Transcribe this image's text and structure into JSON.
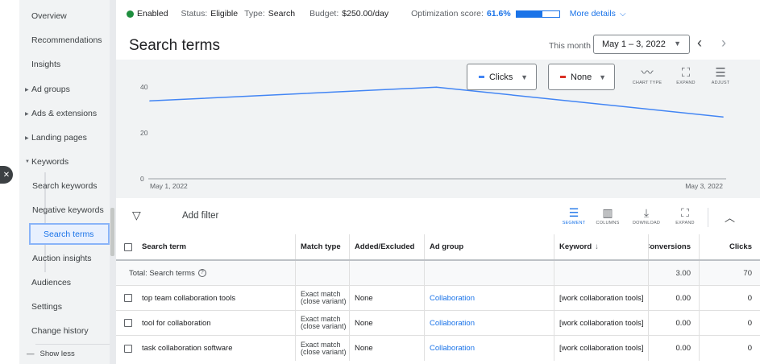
{
  "sidebar": {
    "items": [
      {
        "label": "Overview"
      },
      {
        "label": "Recommendations"
      },
      {
        "label": "Insights"
      },
      {
        "label": "Ad groups"
      },
      {
        "label": "Ads & extensions"
      },
      {
        "label": "Landing pages"
      },
      {
        "label": "Keywords"
      },
      {
        "label": "Search keywords"
      },
      {
        "label": "Negative keywords"
      },
      {
        "label": "Search terms"
      },
      {
        "label": "Auction insights"
      },
      {
        "label": "Audiences"
      },
      {
        "label": "Settings"
      },
      {
        "label": "Change history"
      }
    ],
    "show_less": "Show less"
  },
  "status": {
    "enabled": "Enabled",
    "status_label": "Status:",
    "status_value": "Eligible",
    "type_label": "Type:",
    "type_value": "Search",
    "budget_label": "Budget:",
    "budget_value": "$250.00/day",
    "opt_label": "Optimization score:",
    "opt_value": "61.6%",
    "opt_fraction": 0.616,
    "more_details": "More details"
  },
  "header": {
    "title": "Search terms",
    "this_month": "This month",
    "date_range": "May 1 – 3, 2022"
  },
  "chart_controls": {
    "metric1": "Clicks",
    "metric2": "None",
    "chart_type": "CHART TYPE",
    "expand": "EXPAND",
    "adjust": "ADJUST"
  },
  "chart_data": {
    "type": "line",
    "x": [
      "May 1, 2022",
      "May 2, 2022",
      "May 3, 2022"
    ],
    "x_tick_labels": [
      "May 1, 2022",
      "May 3, 2022"
    ],
    "series": [
      {
        "name": "Clicks",
        "values": [
          34,
          40,
          27
        ]
      }
    ],
    "y_ticks": [
      0,
      20,
      40
    ],
    "ylim": [
      0,
      45
    ],
    "series_color": "#4285f4"
  },
  "toolbar": {
    "add_filter": "Add filter",
    "segment": "SEGMENT",
    "columns": "COLUMNS",
    "download": "DOWNLOAD",
    "expand": "EXPAND"
  },
  "table": {
    "headers": {
      "search_term": "Search term",
      "match_type": "Match type",
      "added_excluded": "Added/Excluded",
      "ad_group": "Ad group",
      "keyword": "Keyword",
      "conversions": "Conversions",
      "clicks": "Clicks"
    },
    "total": {
      "label": "Total: Search terms",
      "conversions": "3.00",
      "clicks": "70"
    },
    "rows": [
      {
        "search_term": "top team collaboration tools",
        "match_type": "Exact match (close variant)",
        "added_excluded": "None",
        "ad_group": "Collaboration",
        "keyword": "[work collaboration tools]",
        "conversions": "0.00",
        "clicks": "0"
      },
      {
        "search_term": "tool for collaboration",
        "match_type": "Exact match (close variant)",
        "added_excluded": "None",
        "ad_group": "Collaboration",
        "keyword": "[work collaboration tools]",
        "conversions": "0.00",
        "clicks": "0"
      },
      {
        "search_term": "task collaboration software",
        "match_type": "Exact match (close variant)",
        "added_excluded": "None",
        "ad_group": "Collaboration",
        "keyword": "[work collaboration tools]",
        "conversions": "0.00",
        "clicks": "0"
      }
    ]
  }
}
